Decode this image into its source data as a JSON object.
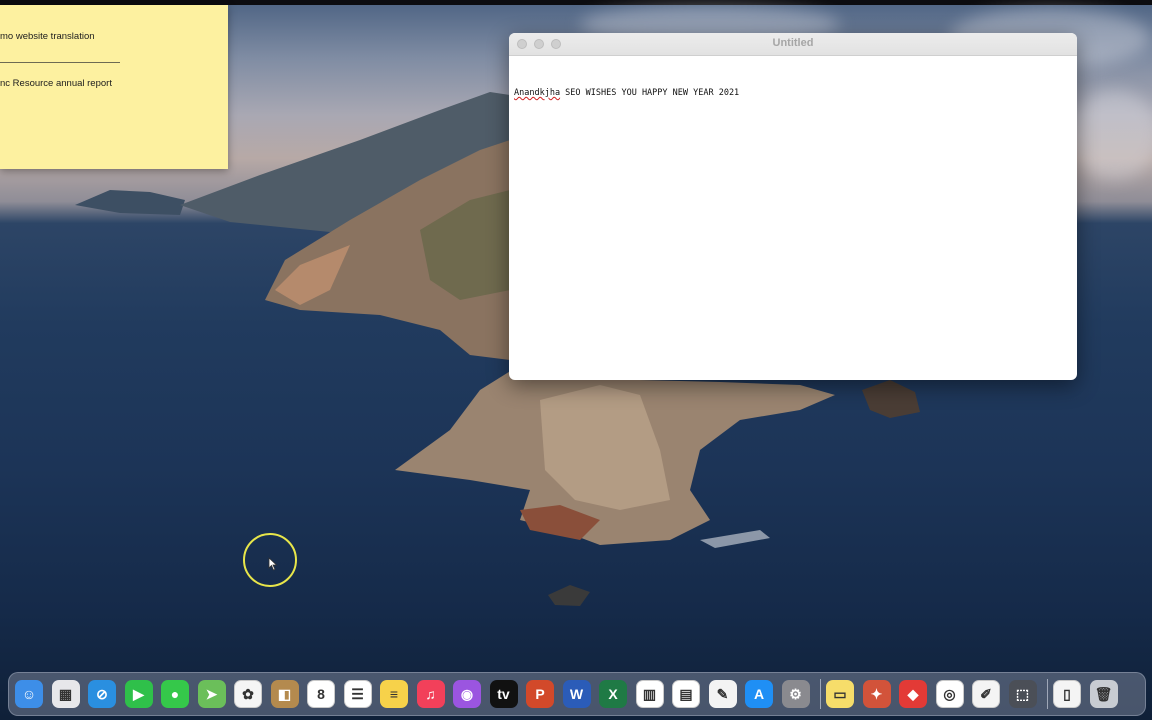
{
  "sticky_note": {
    "line1": "mo website translation",
    "line2": "nc Resource annual report"
  },
  "textedit": {
    "title": "Untitled",
    "misspelled_word": "Anandkjha",
    "body_rest": " SEO WISHES YOU HAPPY NEW YEAR 2021"
  },
  "dock": {
    "apps": [
      {
        "icon": "finder-icon",
        "glyph": "☺",
        "color": "#3d8ee8"
      },
      {
        "icon": "launchpad-icon",
        "glyph": "▦",
        "color": "#e7e7ea"
      },
      {
        "icon": "safari-icon",
        "glyph": "⊘",
        "color": "#2a8fe0"
      },
      {
        "icon": "facetime-icon",
        "glyph": "▶",
        "color": "#2fc04a"
      },
      {
        "icon": "messages-icon",
        "glyph": "●",
        "color": "#35c84a"
      },
      {
        "icon": "maps-icon",
        "glyph": "➤",
        "color": "#6bbf5a"
      },
      {
        "icon": "photos-icon",
        "glyph": "✿",
        "color": "#f5f5f5"
      },
      {
        "icon": "contacts-icon",
        "glyph": "◧",
        "color": "#b48a4e"
      },
      {
        "icon": "calendar-icon",
        "glyph": "8",
        "color": "#ffffff"
      },
      {
        "icon": "reminders-icon",
        "glyph": "☰",
        "color": "#ffffff"
      },
      {
        "icon": "notes-icon",
        "glyph": "≡",
        "color": "#f7d24a"
      },
      {
        "icon": "music-icon",
        "glyph": "♫",
        "color": "#f2405a"
      },
      {
        "icon": "podcasts-icon",
        "glyph": "◉",
        "color": "#9b55e0"
      },
      {
        "icon": "apple-tv-icon",
        "glyph": "tv",
        "color": "#111111"
      },
      {
        "icon": "powerpoint-icon",
        "glyph": "P",
        "color": "#d2492a"
      },
      {
        "icon": "word-icon",
        "glyph": "W",
        "color": "#2b5cb8"
      },
      {
        "icon": "excel-icon",
        "glyph": "X",
        "color": "#1f7a45"
      },
      {
        "icon": "numbers-icon",
        "glyph": "▥",
        "color": "#ffffff"
      },
      {
        "icon": "keynote-icon",
        "glyph": "▤",
        "color": "#ffffff"
      },
      {
        "icon": "pages-icon",
        "glyph": "✎",
        "color": "#f3f3f3"
      },
      {
        "icon": "app-store-icon",
        "glyph": "A",
        "color": "#1f8ff5"
      },
      {
        "icon": "system-preferences-icon",
        "glyph": "⚙",
        "color": "#8a8a8f"
      },
      {
        "icon": "stickies-icon",
        "glyph": "▭",
        "color": "#f6dd6a"
      },
      {
        "icon": "photo-booth-icon",
        "glyph": "✦",
        "color": "#d2533a"
      },
      {
        "icon": "anydesk-icon",
        "glyph": "◆",
        "color": "#e33a36"
      },
      {
        "icon": "chrome-icon",
        "glyph": "◎",
        "color": "#ffffff"
      },
      {
        "icon": "textedit-icon",
        "glyph": "✐",
        "color": "#f4f4f4"
      },
      {
        "icon": "screenshot-icon",
        "glyph": "⬚",
        "color": "#4b4f57"
      },
      {
        "icon": "document-icon",
        "glyph": "▯",
        "color": "#f4f4f4"
      },
      {
        "icon": "trash-icon",
        "glyph": "🗑",
        "color": "#c8ccd2"
      }
    ]
  }
}
